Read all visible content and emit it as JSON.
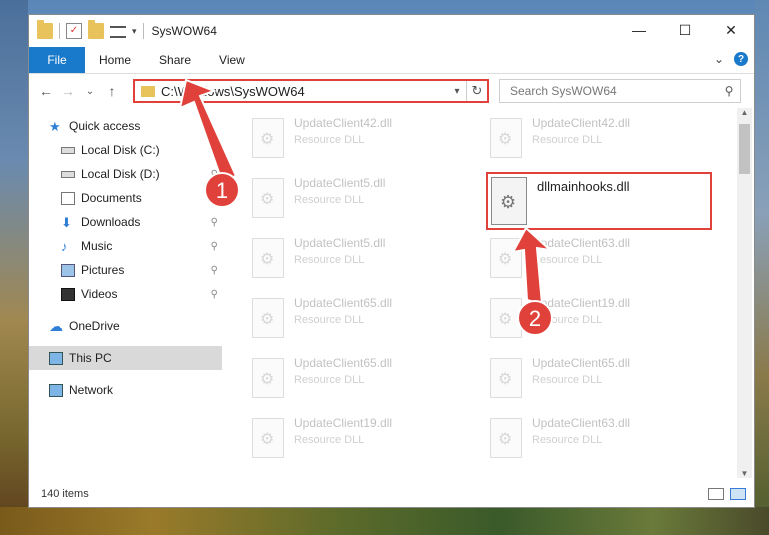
{
  "window": {
    "title": "SysWOW64",
    "minimize": "—",
    "maximize": "☐",
    "close": "✕"
  },
  "ribbon": {
    "file": "File",
    "tabs": [
      "Home",
      "Share",
      "View"
    ],
    "expand": "⌄",
    "help": "?"
  },
  "navbar": {
    "back": "←",
    "forward": "→",
    "recent": "⌄",
    "up": "↑",
    "path": "C:\\Windows\\SysWOW64",
    "refresh": "↻",
    "search_placeholder": "Search SysWOW64",
    "search_icon": "⚲"
  },
  "sidebar": {
    "items": [
      {
        "label": "Quick access",
        "icon": "star-icon",
        "pinned": false
      },
      {
        "label": "Local Disk (C:)",
        "icon": "drive-icon",
        "pinned": true
      },
      {
        "label": "Local Disk (D:)",
        "icon": "drive-icon",
        "pinned": true
      },
      {
        "label": "Documents",
        "icon": "documents-icon",
        "pinned": true
      },
      {
        "label": "Downloads",
        "icon": "download-icon",
        "pinned": true
      },
      {
        "label": "Music",
        "icon": "music-icon",
        "pinned": true
      },
      {
        "label": "Pictures",
        "icon": "pictures-icon",
        "pinned": true
      },
      {
        "label": "Videos",
        "icon": "videos-icon",
        "pinned": true
      },
      {
        "label": "OneDrive",
        "icon": "cloud-icon",
        "pinned": false
      },
      {
        "label": "This PC",
        "icon": "pc-icon",
        "pinned": false
      },
      {
        "label": "Network",
        "icon": "network-icon",
        "pinned": false
      }
    ],
    "pin_glyph": "📌"
  },
  "files": {
    "left_column": [
      {
        "name": "UpdateClient42.dll",
        "type": "Resource DLL"
      },
      {
        "name": "UpdateClient5.dll",
        "type": "Resource DLL"
      },
      {
        "name": "UpdateClient5.dll",
        "type": "Resource DLL"
      },
      {
        "name": "UpdateClient65.dll",
        "type": "Resource DLL"
      },
      {
        "name": "UpdateClient65.dll",
        "type": "Resource DLL"
      },
      {
        "name": "UpdateClient19.dll",
        "type": "Resource DLL"
      }
    ],
    "right_column": [
      {
        "name": "UpdateClient42.dll",
        "type": "Resource DLL"
      },
      {
        "name": "UpdateClient63.dll",
        "type": "Resource DLL"
      },
      {
        "name": "UpdateClient19.dll",
        "type": "Resource DLL"
      },
      {
        "name": "UpdateClient65.dll",
        "type": "Resource DLL"
      },
      {
        "name": "UpdateClient63.dll",
        "type": "Resource DLL"
      }
    ],
    "highlighted": {
      "name": "dllmainhooks.dll"
    }
  },
  "status": {
    "item_count": "140 items"
  },
  "annotations": {
    "badge1": "1",
    "badge2": "2",
    "color": "#e0413b"
  }
}
